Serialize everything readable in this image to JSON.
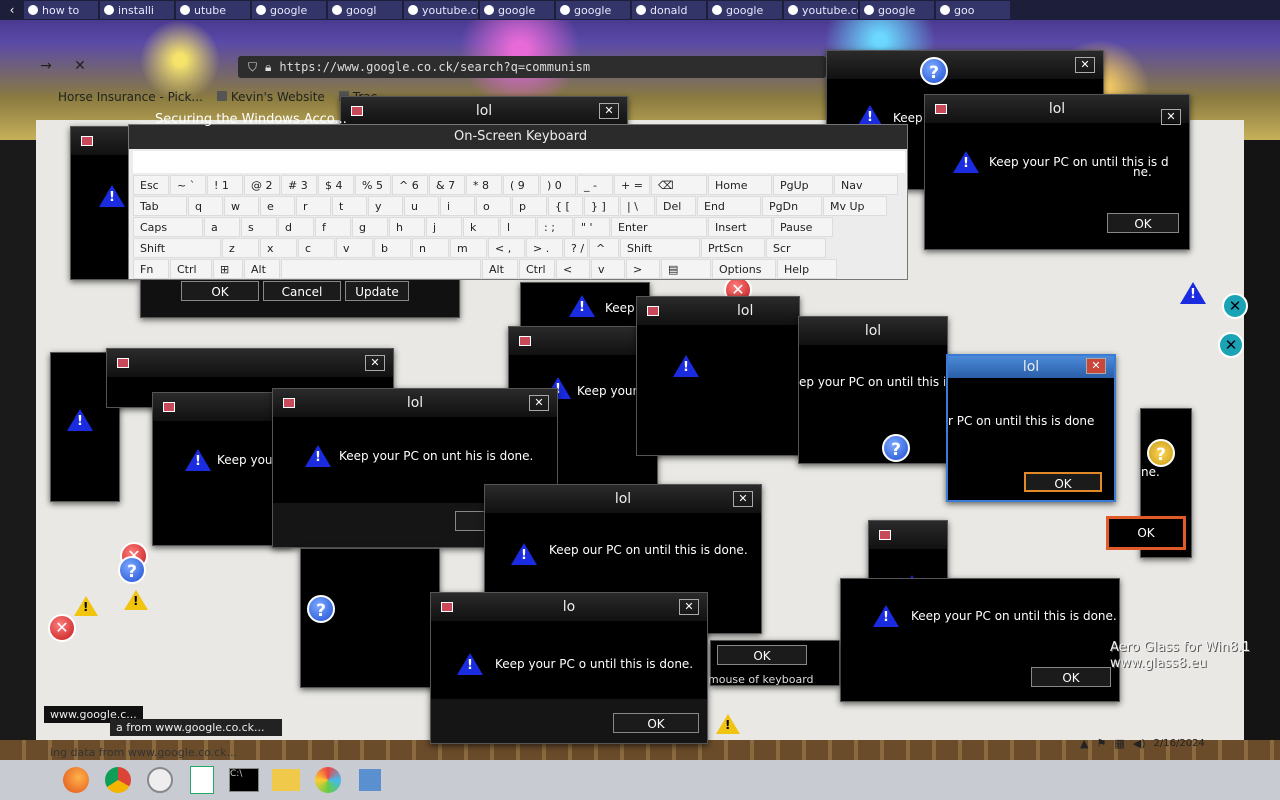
{
  "tabs": [
    "how to",
    "installi",
    "utube",
    "google",
    "googl",
    "youtube.co",
    "google",
    "google",
    "donald",
    "google",
    "youtube.co",
    "google",
    "goo"
  ],
  "toolbar": {
    "url": "https://www.google.co.ck/search?q=communism"
  },
  "bookmarks": [
    "Horse Insurance - Pick...",
    "Kevin's Website",
    "Trac"
  ],
  "page_heading": "Securing the Windows Acco...",
  "keyboard": {
    "title": "On-Screen Keyboard",
    "rows": [
      [
        "Esc",
        "~ `",
        "! 1",
        "@ 2",
        "# 3",
        "$ 4",
        "% 5",
        "^ 6",
        "& 7",
        "* 8",
        "( 9",
        ") 0",
        "_ -",
        "+ =",
        "⌫",
        "Home",
        "PgUp",
        "Nav"
      ],
      [
        "Tab",
        "q",
        "w",
        "e",
        "r",
        "t",
        "y",
        "u",
        "i",
        "o",
        "p",
        "{ [",
        "} ]",
        "| \\",
        "Del",
        "End",
        "PgDn",
        "Mv Up"
      ],
      [
        "Caps",
        "a",
        "s",
        "d",
        "f",
        "g",
        "h",
        "j",
        "k",
        "l",
        ": ;",
        "\" '",
        "Enter",
        "Insert",
        "Pause"
      ],
      [
        "Shift",
        "z",
        "x",
        "c",
        "v",
        "b",
        "n",
        "m",
        "< ,",
        "> .",
        "? /",
        "^",
        "Shift",
        "PrtScn",
        "Scr"
      ],
      [
        "Fn",
        "Ctrl",
        "⊞",
        "Alt",
        "",
        "Alt",
        "Ctrl",
        "<",
        "v",
        ">",
        "▤",
        "Options",
        "Help"
      ]
    ]
  },
  "pin_dialog": {
    "ok": "OK",
    "cancel": "Cancel",
    "update": "Update"
  },
  "dialogs": {
    "title": "lol",
    "title_short": "lo",
    "message": "Keep your PC on until this is done.",
    "message_partial_1": "Keep your PC on until this is d",
    "message_partial_2": "ne.",
    "message_partial_3": "Keep your P",
    "message_partial_4": "Keep y",
    "message_partial_5": "ep your PC on until this is done",
    "message_partial_6": "r PC on until this is done",
    "message_partial_7": "Keep our PC on until this is done.",
    "message_partial_8": "Keep your PC o until this is done.",
    "message_partial_9": "Keep your PC on unt  his is done.",
    "message_partial_10": "Keep",
    "ok": "OK",
    "update": "Update",
    "close": "✕"
  },
  "status": {
    "tip1": "www.google.c...",
    "tip2": "a from www.google.co.ck...",
    "tip3": "ing data from www.google.co.ck..."
  },
  "watermark": [
    "Aero Glass for Win8.1",
    "www.glass8.eu"
  ],
  "mouse_text": "mouse of keyboard",
  "tray": {
    "time": "2/16/2024"
  },
  "taskbar_apps": [
    "firefox-icon",
    "chrome-icon",
    "clock-icon",
    "notepad-icon",
    "cmd-icon",
    "folder-icon",
    "paint-icon",
    "app-icon"
  ],
  "colors": {
    "accent_warning": "#1a2be0",
    "outline_focus": "#e05a2a"
  }
}
